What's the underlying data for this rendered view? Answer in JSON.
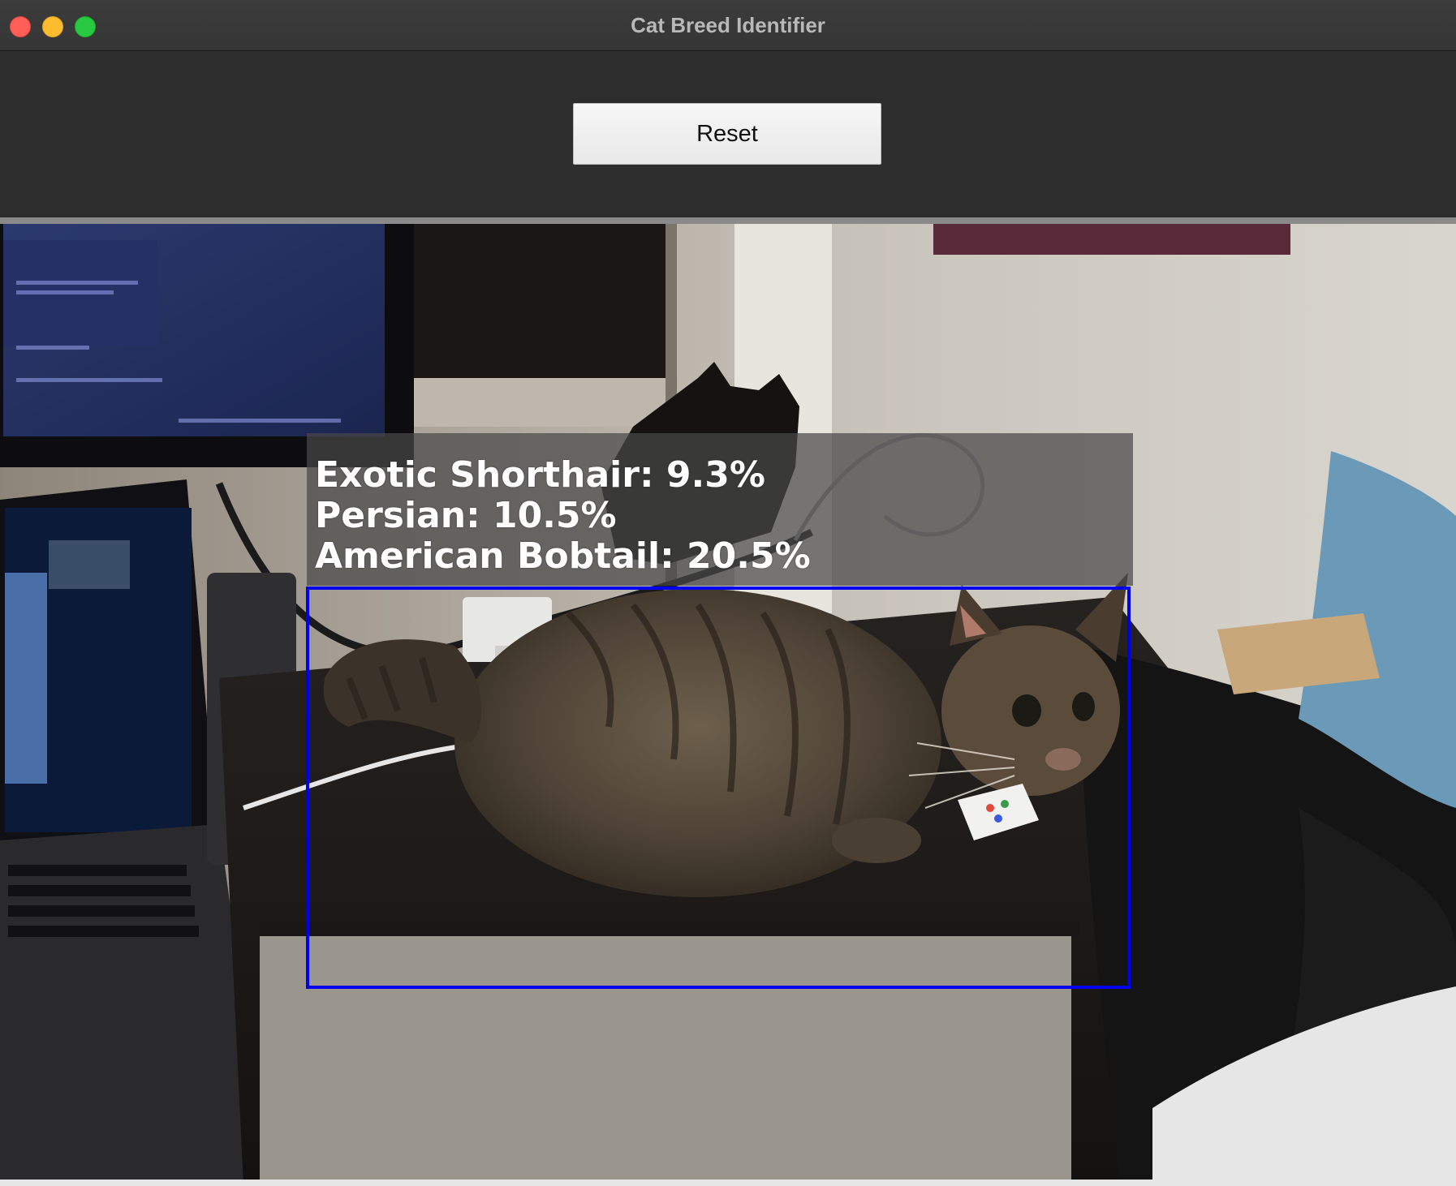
{
  "window": {
    "title": "Cat Breed Identifier"
  },
  "toolbar": {
    "reset_label": "Reset"
  },
  "detection": {
    "predictions": [
      {
        "breed": "Exotic Shorthair",
        "confidence_percent": 9.3,
        "text": "Exotic Shorthair: 9.3%"
      },
      {
        "breed": "Persian",
        "confidence_percent": 10.5,
        "text": "Persian: 10.5%"
      },
      {
        "breed": "American Bobtail",
        "confidence_percent": 20.5,
        "text": "American Bobtail: 20.5%"
      }
    ],
    "box_color": "#0000ee",
    "label_color": "#ffffff"
  },
  "colors": {
    "close": "#ff5f57",
    "minimize": "#febc2e",
    "maximize": "#28c840"
  }
}
